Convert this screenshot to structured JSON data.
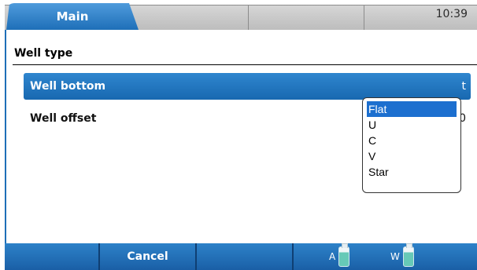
{
  "header": {
    "tabs": [
      {
        "label": "Main",
        "active": true
      },
      {
        "label": "",
        "active": false
      },
      {
        "label": "",
        "active": false
      }
    ],
    "time": "10:39"
  },
  "section": {
    "title": "Well type"
  },
  "rows": [
    {
      "label": "Well bottom",
      "value_peek": "t",
      "selected": true
    },
    {
      "label": "Well offset",
      "value_peek": "0",
      "selected": false
    }
  ],
  "dropdown": {
    "options": [
      "Flat",
      "U",
      "C",
      "V",
      "Star"
    ],
    "selected": "Flat"
  },
  "footer": {
    "cancel_label": "Cancel",
    "reservoir_a": "A",
    "reservoir_w": "W"
  },
  "colors": {
    "accent": "#1e6fb8",
    "selection": "#1c6fcf",
    "reservoir_liquid": "#66c9b7"
  }
}
